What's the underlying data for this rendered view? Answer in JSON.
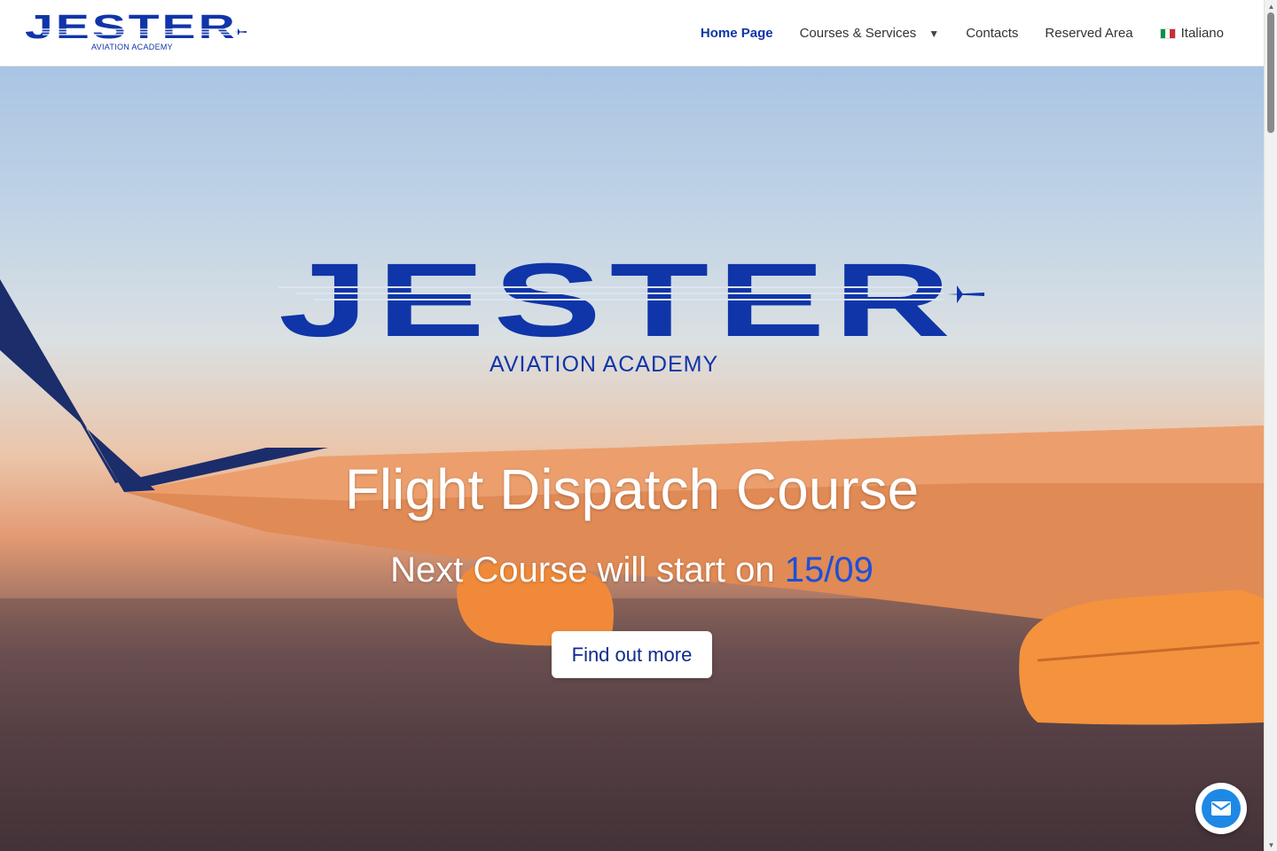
{
  "header": {
    "logo_text": "JESTER",
    "logo_subtitle": "AVIATION ACADEMY",
    "nav": [
      {
        "label": "Home Page",
        "active": true
      },
      {
        "label": "Courses & Services",
        "has_dropdown": true
      },
      {
        "label": "Contacts"
      },
      {
        "label": "Reserved Area"
      },
      {
        "label": "Italiano",
        "flag": "italy-flag-icon"
      }
    ]
  },
  "hero": {
    "logo_text": "JESTER",
    "logo_subtitle": "AVIATION ACADEMY",
    "title": "Flight Dispatch Course",
    "subtitle_prefix": "Next Course will start on ",
    "subtitle_date": "15/09",
    "cta_label": "Find out more"
  },
  "fab": {
    "icon": "mail-icon"
  },
  "colors": {
    "brand": "#0f35a8",
    "accent_date": "#1d4fd9",
    "fab": "#1e88e5"
  }
}
